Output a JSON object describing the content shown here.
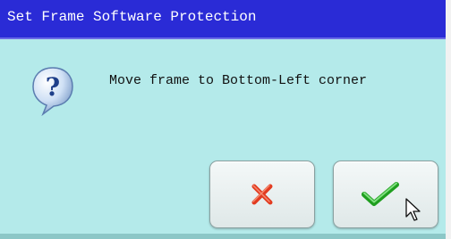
{
  "dialog": {
    "title": "Set Frame Software Protection",
    "message": "Move frame to Bottom-Left corner"
  },
  "icons": {
    "question": "question-mark-icon",
    "cancel": "red-x-icon",
    "confirm": "green-checkmark-icon",
    "pointer": "mouse-cursor-icon"
  },
  "colors": {
    "titlebar": "#2a2bd6",
    "background": "#b4eaea",
    "cancel": "#e23a1f",
    "confirm": "#27b827"
  }
}
